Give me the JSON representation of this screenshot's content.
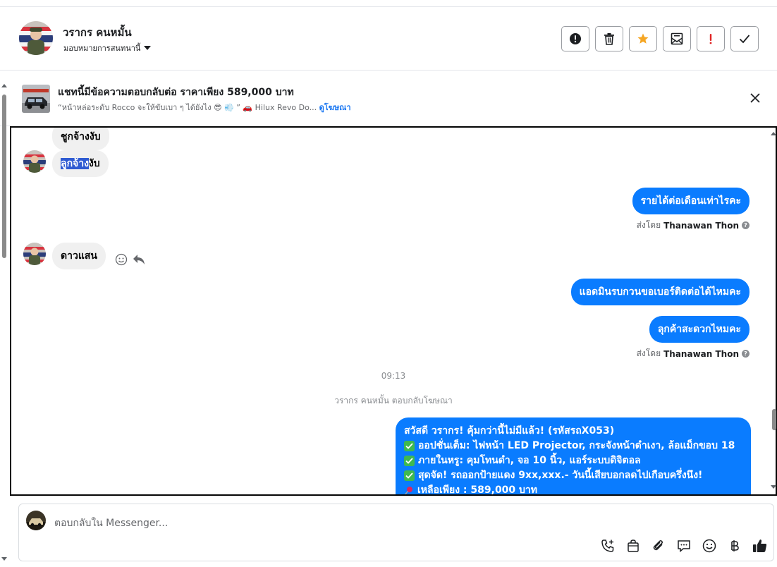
{
  "header": {
    "contact_name": "วรากร คนหมั้น",
    "assign_label": "มอบหมายการสนทนานี้",
    "actions": [
      {
        "name": "report-icon",
        "label": "report"
      },
      {
        "name": "trash-icon",
        "label": "delete"
      },
      {
        "name": "star-icon",
        "label": "star"
      },
      {
        "name": "mark-unread-icon",
        "label": "unread"
      },
      {
        "name": "follow-up-icon",
        "label": "follow up"
      },
      {
        "name": "checkmark-icon",
        "label": "done"
      }
    ]
  },
  "ad_banner": {
    "title": "แชทนี้มีข้อความตอบกลับต่อ ราคาเพียง 589,000 บาท",
    "description": "“หน้าหล่อระดับ Rocco จะให้ขับเบา ๆ ได้ยังไง 😎 💨 ” 🚗 Hilux Revo Do...",
    "link": "ดูโฆษณา"
  },
  "chat": {
    "messages": [
      {
        "text": "ชูกจ้างงับ"
      },
      {
        "text_selected": "ลูกจ้าง",
        "text_rest": "งับ"
      },
      {
        "text": "รายได้ต่อเดือนเท่าไรคะ"
      },
      {
        "text": "ดาวแสน"
      },
      {
        "text": "แอดมินรบกวนขอเบอร์ติดต่อได้ไหมคะ"
      },
      {
        "text": "ลุกค้าสะดวกไหมคะ"
      }
    ],
    "sent_by_prefix": "ส่งโดย",
    "sent_by_name": "Thanawan Thon",
    "timestamp": "09:13",
    "ad_reply_note": "วรากร คนหมั้น ตอบกลับโฆษณา",
    "ad_message_lines": [
      "สวัสดี วรากร! คุ้มกว่านี้ไม่มีแล้ว! (รหัสรถX053)",
      "ออปชั่นเต็ม: ไฟหน้า LED Projector, กระจังหน้าดำเงา, ล้อแม็กขอบ 18",
      "ภายในหรู: คุมโทนดำ, จอ 10 นิ้ว, แอร์ระบบดิจิตอล",
      "สุดจัด! รถออกป้ายแดง 9xx,xxx.- วันนี้เสียบอกลดไปเกือบครึ่งนึง!",
      "เหลือเพียง : 589,000 บาท"
    ]
  },
  "composer": {
    "placeholder": "ตอบกลับใน Messenger..."
  },
  "colors": {
    "bubble_out": "#0a7cff",
    "bubble_in": "#f0f0f0",
    "link": "#1876f2",
    "star": "#f5a623",
    "follow_up": "#e02424"
  }
}
